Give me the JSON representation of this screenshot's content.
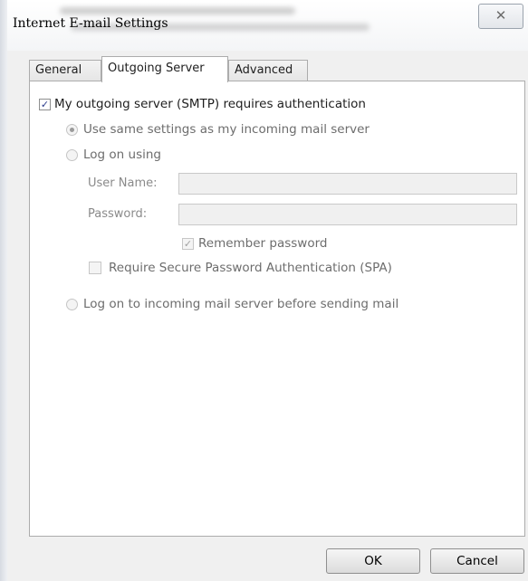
{
  "window": {
    "title": "Internet E-mail Settings",
    "close_glyph": "✕"
  },
  "tabs": [
    {
      "label": "General",
      "active": false
    },
    {
      "label": "Outgoing Server",
      "active": true
    },
    {
      "label": "Advanced",
      "active": false
    }
  ],
  "outgoing": {
    "requires_auth_label": "My outgoing server (SMTP) requires authentication",
    "requires_auth_checked": true,
    "use_same_label": "Use same settings as my incoming mail server",
    "use_same_selected": true,
    "log_on_using_label": "Log on using",
    "user_name_label": "User Name:",
    "user_name_value": "",
    "password_label": "Password:",
    "password_value": "",
    "remember_password_label": "Remember password",
    "remember_password_checked": true,
    "spa_label": "Require Secure Password Authentication (SPA)",
    "spa_checked": false,
    "log_on_incoming_label": "Log on to incoming mail server before sending mail"
  },
  "buttons": {
    "ok": "OK",
    "cancel": "Cancel"
  },
  "icons": {
    "check": "✓"
  }
}
